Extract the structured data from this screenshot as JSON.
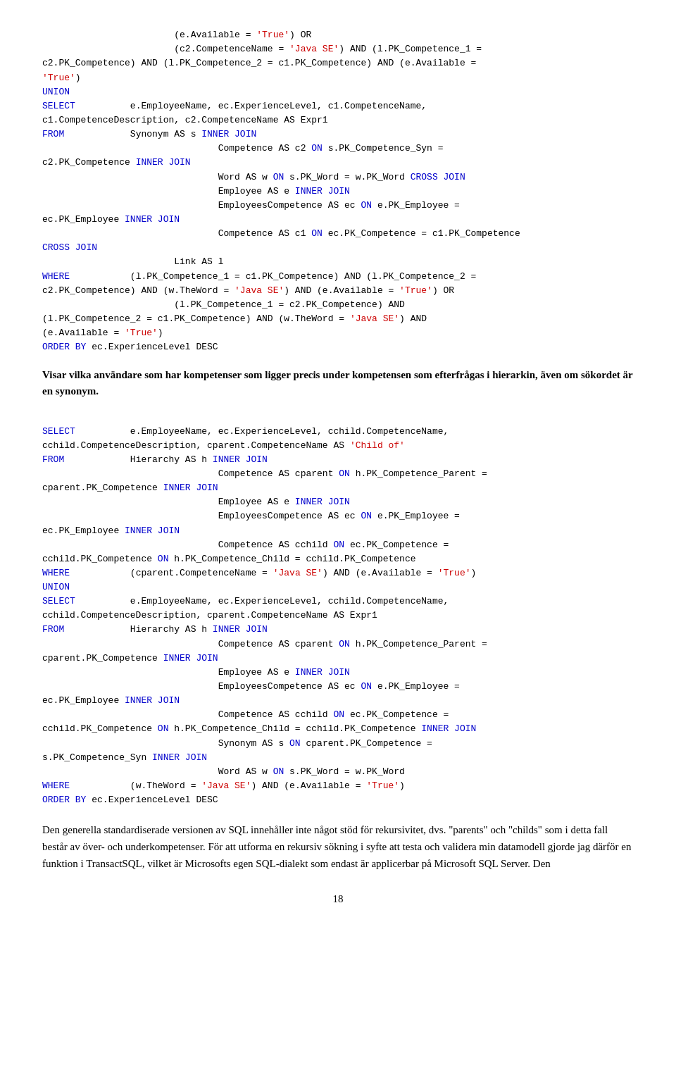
{
  "page": {
    "number": "18"
  },
  "description1": {
    "text": "Visar vilka användare som har kompetenser som ligger precis under kompetensen som efter-frågas i hierarkin, även om sökordet är en synonym."
  },
  "description2": {
    "text": "Den generella standardiserade versionen av SQL innehåller inte något stöd för rekursivitet, dvs. \"parents\" och \"childs\" som i detta fall består av över- och underkompetenser. För att utforma en rekursiv sökning i syfte att testa och validera min datamodell gjorde jag därför en funktion i TransactSQL, vilket är Microsofts egen SQL-dialekt som endast är applicerbar på Microsoft SQL Server. Den"
  }
}
